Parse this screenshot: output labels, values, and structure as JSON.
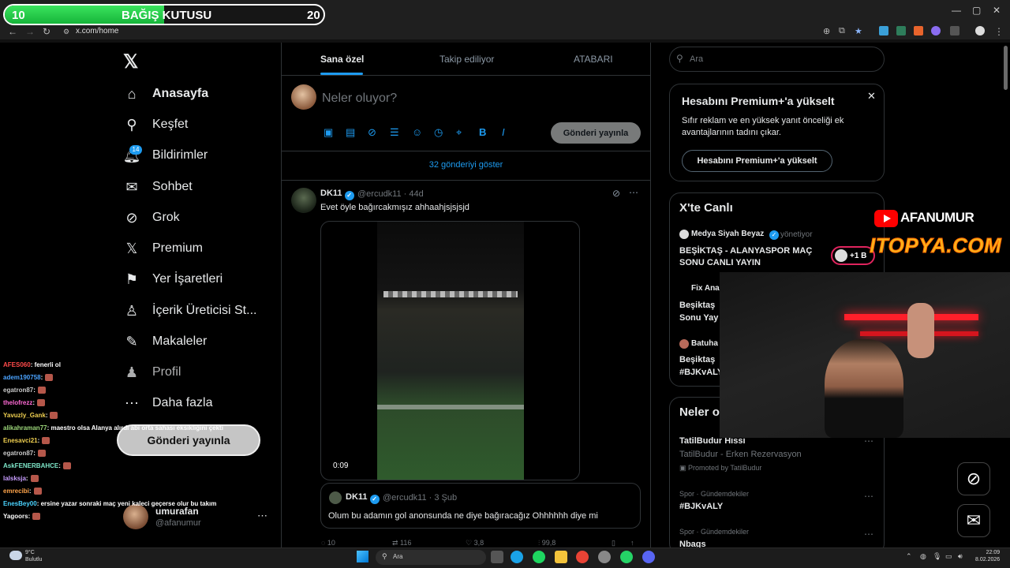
{
  "donation": {
    "left_value": "10",
    "title": "BAĞIŞ KUTUSU",
    "right_value": "20",
    "progress": 0.5
  },
  "browser": {
    "url": "x.com/home"
  },
  "nav": {
    "items": [
      {
        "label": "Anasayfa",
        "icon": "home-icon"
      },
      {
        "label": "Keşfet",
        "icon": "search-icon"
      },
      {
        "label": "Bildirimler",
        "icon": "bell-icon",
        "badge": "14"
      },
      {
        "label": "Sohbet",
        "icon": "mail-icon"
      },
      {
        "label": "Grok",
        "icon": "grok-icon"
      },
      {
        "label": "Premium",
        "icon": "x-logo-icon"
      },
      {
        "label": "Yer İşaretleri",
        "icon": "bookmark-icon"
      },
      {
        "label": "İçerik Üreticisi St...",
        "icon": "creator-icon"
      },
      {
        "label": "Makaleler",
        "icon": "article-icon"
      },
      {
        "label": "Profil",
        "icon": "profile-icon"
      },
      {
        "label": "Daha fazla",
        "icon": "more-icon"
      }
    ],
    "post_button": "Gönderi yayınla",
    "account": {
      "name": "umurafan",
      "handle": "@afanumur"
    }
  },
  "chat": [
    {
      "user": "AFES060",
      "msg": ": fenerli ol",
      "color": "#ff4a4a"
    },
    {
      "user": "adem190758",
      "msg": " :",
      "color": "#4aa3ff"
    },
    {
      "user": "egatron87",
      "msg": " :",
      "color": "#c8c8c8"
    },
    {
      "user": "thelofrezz",
      "msg": " :",
      "color": "#ff6ad5"
    },
    {
      "user": "Yavuzly_Gank",
      "msg": " :",
      "color": "#f0d050"
    },
    {
      "user": "alikahraman77",
      "msg": " : maestro olsa Alanya alırdı abi orta sahası eksikliğini çekti",
      "color": "#9cd67a"
    },
    {
      "user": "Enesavci21",
      "msg": " :",
      "color": "#f0d050"
    },
    {
      "user": "egatron87",
      "msg": " :",
      "color": "#c8c8c8"
    },
    {
      "user": "AskFENERBAHCE",
      "msg": " :",
      "color": "#7ee7c9"
    },
    {
      "user": "lalsksja",
      "msg": " :",
      "color": "#c79cff"
    },
    {
      "user": "emrecibi",
      "msg": " :",
      "color": "#ffa44a"
    },
    {
      "user": "EnesBey00",
      "msg": " : ersine yazar sonraki maç yeni kaleci geçerse olur bu takım",
      "color": "#4ad3ff"
    },
    {
      "user": "Yagoors",
      "msg": " :",
      "color": "#ffffff"
    }
  ],
  "tabs": [
    "Sana özel",
    "Takip ediliyor",
    "ATABARI"
  ],
  "compose": {
    "placeholder": "Neler oluyor?",
    "button": "Gönderi yayınla"
  },
  "show_posts": "32 gönderiyi göster",
  "tweet": {
    "name": "DK11",
    "handle": "@ercudk11 · 44d",
    "text": "Evet öyle bağırcakmışız ahhaahjsjsjsjd",
    "duration": "0:09",
    "quote": {
      "name": "DK11",
      "handle": "@ercudk11 · 3 Şub",
      "text": "Olum bu adamın gol anonsunda ne diye bağıracağız Ohhhhhh diye mi"
    },
    "actions": [
      "10",
      "116",
      "3,8",
      "99,8"
    ]
  },
  "right": {
    "search_placeholder": "Ara",
    "premium": {
      "title": "Hesabını Premium+'a yükselt",
      "desc": "Sıfır reklam ve en yüksek yanıt önceliği ek avantajlarının tadını çıkar.",
      "button": "Hesabını Premium+'a yükselt"
    },
    "live": {
      "title": "X'te Canlı",
      "items": [
        {
          "host": "Medya Siyah Beyaz",
          "status": "yönetiyor",
          "title": "BEŞİKTAŞ - ALANYASPOR MAÇ SONU CANLI YAYIN"
        },
        {
          "host": "Fix Ana",
          "title1": "Beşiktaş",
          "title2": "Sonu Yay"
        },
        {
          "host": "Batuha",
          "title1": "Beşiktaş",
          "title2": "#BJKvALY"
        }
      ],
      "pill": "+1 B"
    },
    "trends": {
      "title": "Neler o",
      "items": [
        {
          "name": "TatilBudur Hissi",
          "sub": "TatilBudur - Erken Rezervasyon",
          "promo": "Promoted by TatilBudur"
        },
        {
          "context": "Spor · Gündemdekiler",
          "name": "#BJKvALY"
        },
        {
          "context": "Spor · Gündemdekiler",
          "name": "Nbags"
        }
      ]
    }
  },
  "overlay": {
    "youtube": "AFANUMUR",
    "sponsor": "ITOPYA.COM"
  },
  "taskbar": {
    "search": "Ara",
    "weather_temp": "9°C",
    "weather_desc": "Bulutlu",
    "time": "22:09",
    "date": "8.02.2026"
  }
}
